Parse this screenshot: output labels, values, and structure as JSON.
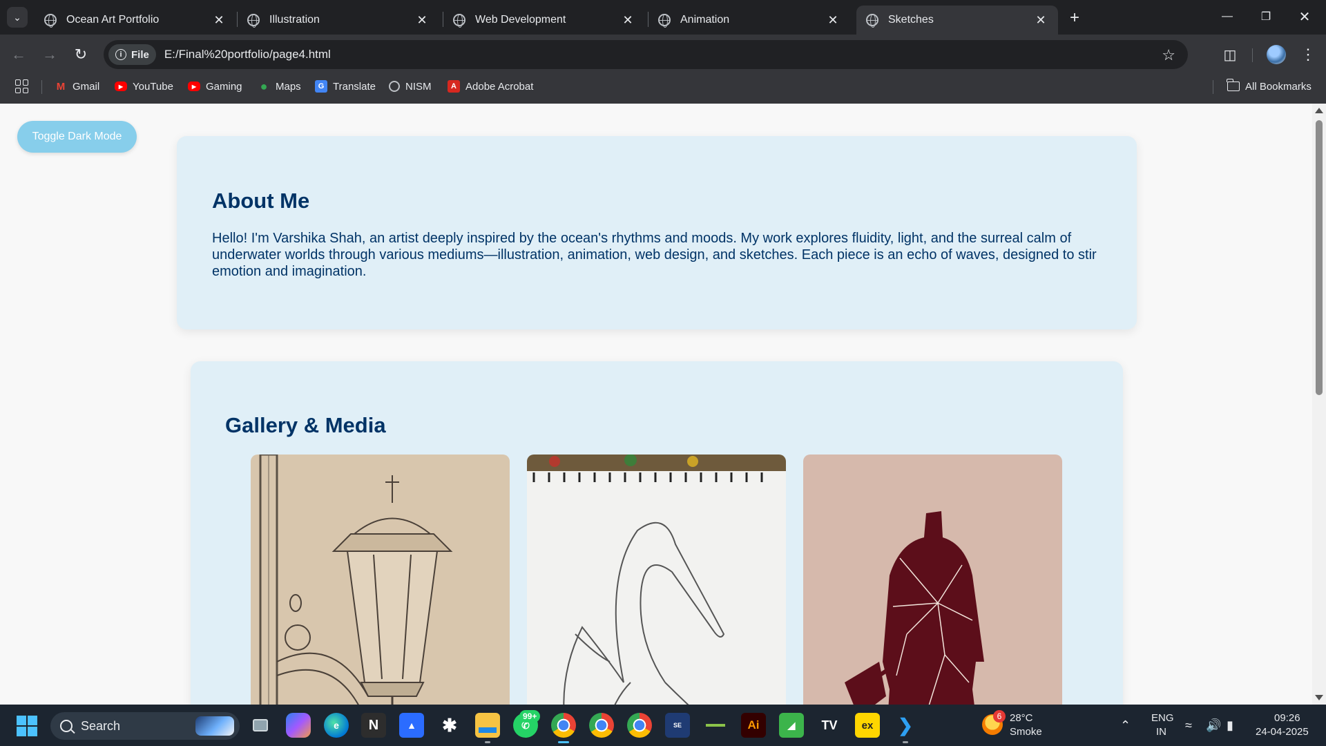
{
  "browser": {
    "tabs": [
      {
        "title": "Ocean Art Portfolio",
        "active": false
      },
      {
        "title": "Illustration",
        "active": false
      },
      {
        "title": "Web Development",
        "active": false
      },
      {
        "title": "Animation",
        "active": false
      },
      {
        "title": "Sketches",
        "active": true
      }
    ],
    "new_tab_icon": "+",
    "url_chip_label": "File",
    "url": "E:/Final%20portfolio/page4.html",
    "bookmarks": [
      {
        "label": "Gmail",
        "icon": "gmail-icon"
      },
      {
        "label": "YouTube",
        "icon": "youtube-icon"
      },
      {
        "label": "Gaming",
        "icon": "youtube-gaming-icon"
      },
      {
        "label": "Maps",
        "icon": "maps-pin-icon"
      },
      {
        "label": "Translate",
        "icon": "translate-icon"
      },
      {
        "label": "NISM",
        "icon": "globe-icon"
      },
      {
        "label": "Adobe Acrobat",
        "icon": "acrobat-icon"
      }
    ],
    "all_bookmarks_label": "All Bookmarks"
  },
  "page": {
    "toggle_label": "Toggle Dark Mode",
    "about": {
      "heading": "About Me",
      "body": "Hello! I'm Varshika Shah, an artist deeply inspired by the ocean's rhythms and moods. My work explores fluidity, light, and the surreal calm of underwater worlds through various mediums—illustration, animation, web design, and sketches. Each piece is an echo of waves, designed to stir emotion and imagination."
    },
    "gallery": {
      "heading": "Gallery & Media",
      "items": [
        "lantern-sketch",
        "swan-sketch",
        "cracked-figure-painting"
      ]
    },
    "colors": {
      "heading": "#003366",
      "card_bg": "#e0eff7",
      "toggle_bg": "#87ceeb"
    }
  },
  "taskbar": {
    "search_label": "Search",
    "whatsapp_badge": "99+",
    "weather_badge": "6",
    "temperature": "28°C",
    "weather_condition": "Smoke",
    "language": "ENG",
    "region": "IN",
    "time": "09:26",
    "date": "24-04-2025"
  }
}
